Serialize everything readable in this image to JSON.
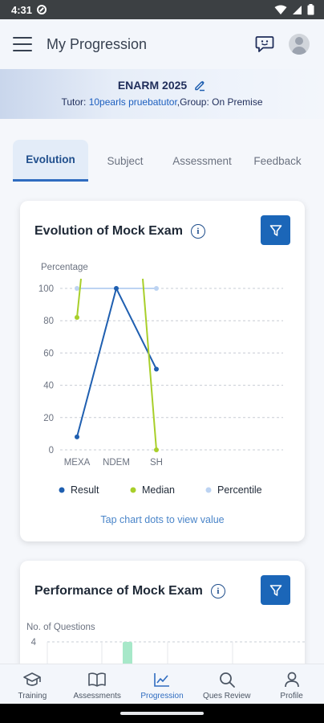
{
  "status_bar": {
    "time": "4:31"
  },
  "app_bar": {
    "title": "My Progression"
  },
  "banner": {
    "exam": "ENARM 2025",
    "tutor_prefix": "Tutor: ",
    "tutor_name": "10pearls pruebatutor",
    "group_text": ",Group: On Premise"
  },
  "tabs": [
    {
      "label": "Evolution",
      "active": true
    },
    {
      "label": "Subject",
      "active": false
    },
    {
      "label": "Assessment",
      "active": false
    },
    {
      "label": "Feedback",
      "active": false
    }
  ],
  "evolution_card": {
    "title": "Evolution of Mock Exam",
    "hint": "Tap chart dots to view value"
  },
  "performance_card": {
    "title": "Performance of Mock Exam"
  },
  "colors": {
    "accent": "#1b66b8",
    "result": "#1f5fb0",
    "median": "#a8cf2a",
    "percentile": "#bcd3f2"
  },
  "chart_data": [
    {
      "type": "line",
      "title": "Evolution of Mock Exam",
      "ylabel": "Percentage",
      "xlabel": "",
      "categories": [
        "MEXA",
        "NDEM",
        "SH"
      ],
      "ylim": [
        0,
        100
      ],
      "yticks": [
        0,
        20,
        40,
        60,
        80,
        100
      ],
      "grid": true,
      "legend_position": "bottom",
      "series": [
        {
          "name": "Result",
          "values": [
            8,
            100,
            50
          ]
        },
        {
          "name": "Median",
          "values": [
            82,
            null,
            0
          ]
        },
        {
          "name": "Percentile",
          "values": [
            100,
            100,
            100
          ]
        }
      ]
    },
    {
      "type": "bar",
      "title": "Performance of Mock Exam",
      "ylabel": "No. of Questions",
      "yticks_visible": [
        4
      ]
    }
  ],
  "bottom_nav": [
    {
      "label": "Training",
      "icon": "graduation-cap-icon",
      "active": false
    },
    {
      "label": "Assessments",
      "icon": "book-icon",
      "active": false
    },
    {
      "label": "Progression",
      "icon": "chart-icon",
      "active": true
    },
    {
      "label": "Ques Review",
      "icon": "search-icon",
      "active": false
    },
    {
      "label": "Profile",
      "icon": "person-icon",
      "active": false
    }
  ]
}
